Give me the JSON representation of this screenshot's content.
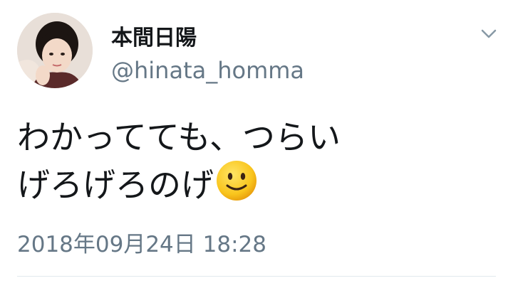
{
  "tweet": {
    "display_name": "本間日陽",
    "handle": "@hinata_homma",
    "text_line_1": "わかってても、つらい",
    "text_line_2": "げろげろのげ",
    "emoji": "slightly-smiling-face-emoji",
    "timestamp": "2018年09月24日 18:28"
  },
  "icons": {
    "menu": "chevron-down-icon"
  },
  "colors": {
    "text_primary": "#14171a",
    "text_secondary": "#657786",
    "divider": "#e1e8ed",
    "background": "#ffffff"
  }
}
